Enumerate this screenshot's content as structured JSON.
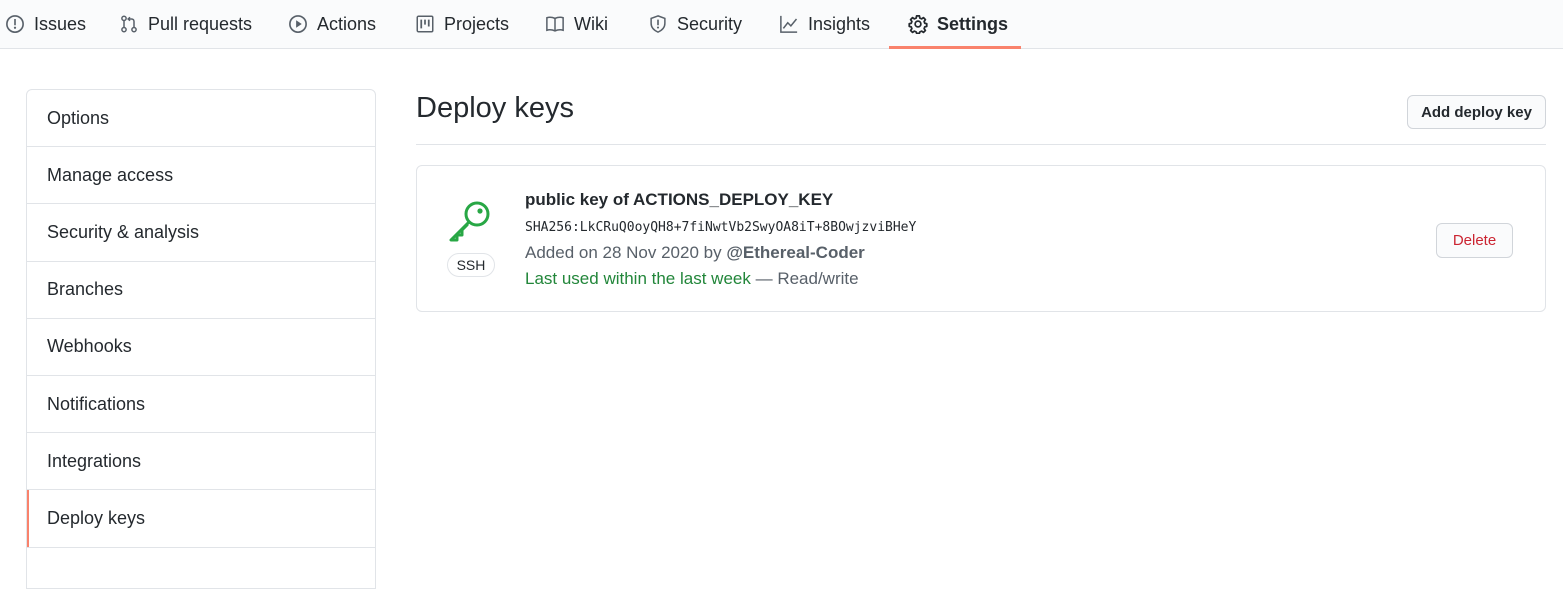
{
  "repo_nav": {
    "tabs": [
      {
        "label": "Issues",
        "icon": "issue-opened-icon"
      },
      {
        "label": "Pull requests",
        "icon": "git-pull-request-icon"
      },
      {
        "label": "Actions",
        "icon": "play-icon"
      },
      {
        "label": "Projects",
        "icon": "project-icon"
      },
      {
        "label": "Wiki",
        "icon": "book-icon"
      },
      {
        "label": "Security",
        "icon": "shield-icon"
      },
      {
        "label": "Insights",
        "icon": "graph-icon"
      },
      {
        "label": "Settings",
        "icon": "gear-icon",
        "selected": true
      }
    ]
  },
  "sidebar": {
    "items": [
      {
        "label": "Options"
      },
      {
        "label": "Manage access"
      },
      {
        "label": "Security & analysis"
      },
      {
        "label": "Branches"
      },
      {
        "label": "Webhooks"
      },
      {
        "label": "Notifications"
      },
      {
        "label": "Integrations"
      },
      {
        "label": "Deploy keys",
        "selected": true
      }
    ]
  },
  "main": {
    "title": "Deploy keys",
    "add_button_label": "Add deploy key",
    "keys": [
      {
        "title": "public key of ACTIONS_DEPLOY_KEY",
        "fingerprint": "SHA256:LkCRuQ0oyQH8+7fiNwtVb2SwyOA8iT+8BOwjzviBHeY",
        "type_badge": "SSH",
        "added_prefix": "Added on 28 Nov 2020 by",
        "added_by": "@Ethereal-Coder",
        "last_used": "Last used within the last week",
        "access": "— Read/write",
        "delete_label": "Delete",
        "icon": "key-icon"
      }
    ]
  },
  "colors": {
    "accent_underline": "#f9826c",
    "key_green": "#28a745",
    "danger_red": "#cb2431",
    "last_used_green": "#22863a"
  }
}
